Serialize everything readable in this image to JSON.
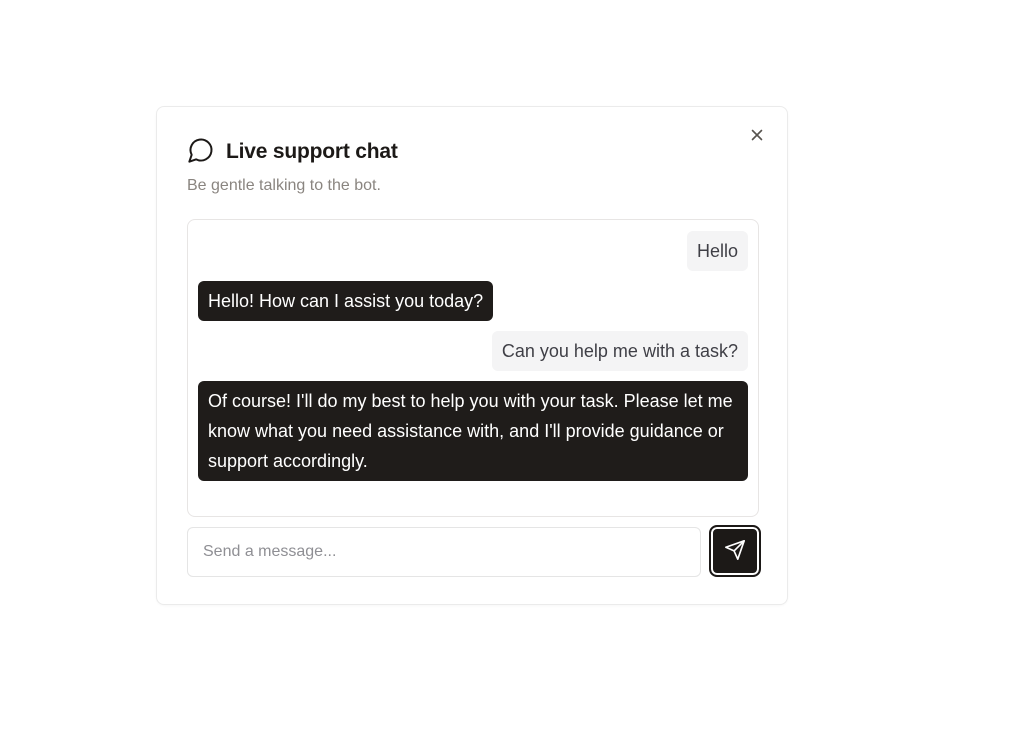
{
  "chat_widget": {
    "title": "Live support chat",
    "subtitle": "Be gentle talking to the bot.",
    "title_icon": "message-circle-icon",
    "close_icon": "close-icon",
    "messages": [
      {
        "role": "user",
        "text": "Hello"
      },
      {
        "role": "bot",
        "text": "Hello! How can I assist you today?"
      },
      {
        "role": "user",
        "text": "Can you help me with a task?"
      },
      {
        "role": "bot",
        "text": "Of course! I'll do my best to help you with your task. Please let me know what you need assistance with, and I'll provide guidance or support accordingly."
      }
    ],
    "input": {
      "value": "",
      "placeholder": "Send a message..."
    },
    "send_icon": "send-icon"
  },
  "colors": {
    "bot_bubble": "#1f1c1a",
    "user_bubble": "#f4f4f5",
    "subtitle_text": "#8a8580",
    "border": "#e7e5e4"
  }
}
